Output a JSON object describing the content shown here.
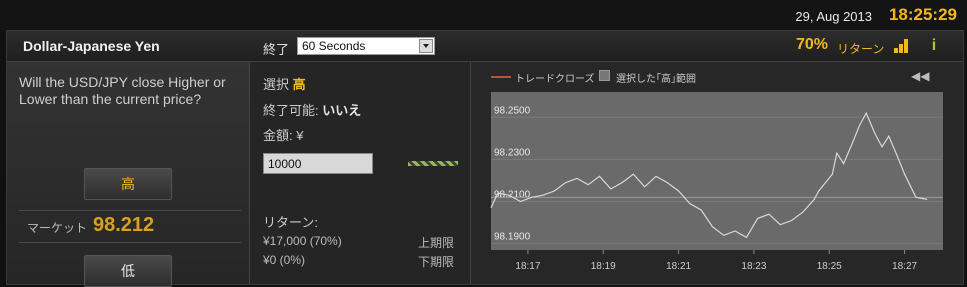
{
  "topbar": {
    "date": "29, Aug 2013",
    "time": "18:25:29"
  },
  "header": {
    "pair": "Dollar-Japanese Yen",
    "expiry_label": "終了",
    "expiry_value": "60 Seconds",
    "return_pct": "70%",
    "return_label": "リターン",
    "icons": [
      "signal-bars-icon",
      "info-icon"
    ]
  },
  "left": {
    "question": "Will the USD/JPY close Higher or Lower than the current price?",
    "high_button": "高",
    "market_label": "マーケット",
    "market_value": "98.212",
    "low_button": "低"
  },
  "middle": {
    "selection_label": "選択",
    "selection_value": "高",
    "expiry_ok_label": "終了可能:",
    "expiry_ok_value": "いいえ",
    "amount_label": "金額: ¥",
    "amount_value": "10000",
    "return_label": "リターン:",
    "upper_return": "¥17,000 (70%)",
    "upper_label": "上期限",
    "lower_return": "¥0 (0%)",
    "lower_label": "下期限"
  },
  "chart": {
    "legend_trade_close": "トレードクローズ",
    "legend_range": "選択した｢高｣範囲",
    "colors": {
      "line": "#d8d8d8",
      "background": "#6a6a6a",
      "trade_close": "#c05040"
    }
  },
  "chart_data": {
    "type": "line",
    "title": "",
    "xlabel": "",
    "ylabel": "",
    "x_ticks": [
      "18:17",
      "18:19",
      "18:21",
      "18:23",
      "18:25",
      "18:27"
    ],
    "y_ticks": [
      "98.2500",
      "98.2300",
      "98.2100",
      "98.1900"
    ],
    "ylim": [
      98.187,
      98.262
    ],
    "xlim": [
      18.267,
      18.467
    ],
    "reference_level": 98.212,
    "series": [
      {
        "x": [
          18.267,
          18.27,
          18.275,
          18.28,
          18.285,
          18.29,
          18.295,
          18.3,
          18.305,
          18.31,
          18.315,
          18.32,
          18.325,
          18.33,
          18.335,
          18.34,
          18.345,
          18.35,
          18.355,
          18.36,
          18.365,
          18.37,
          18.375,
          18.38,
          18.385,
          18.39,
          18.395,
          18.4,
          18.405,
          18.41,
          18.412,
          18.415,
          18.418,
          18.42,
          18.423,
          18.427,
          18.43,
          18.433,
          18.437,
          18.44,
          18.443,
          18.447,
          18.45,
          18.455,
          18.46
        ],
        "y": [
          98.207,
          98.214,
          98.213,
          98.21,
          98.212,
          98.213,
          98.215,
          98.219,
          98.221,
          98.218,
          98.222,
          98.216,
          98.219,
          98.223,
          98.217,
          98.222,
          98.219,
          98.215,
          98.209,
          98.206,
          98.198,
          98.194,
          98.196,
          98.193,
          98.202,
          98.204,
          98.199,
          98.201,
          98.205,
          98.211,
          98.215,
          98.219,
          98.223,
          98.233,
          98.228,
          98.238,
          98.246,
          98.252,
          98.242,
          98.236,
          98.241,
          98.231,
          98.223,
          98.212,
          98.211
        ]
      }
    ]
  }
}
